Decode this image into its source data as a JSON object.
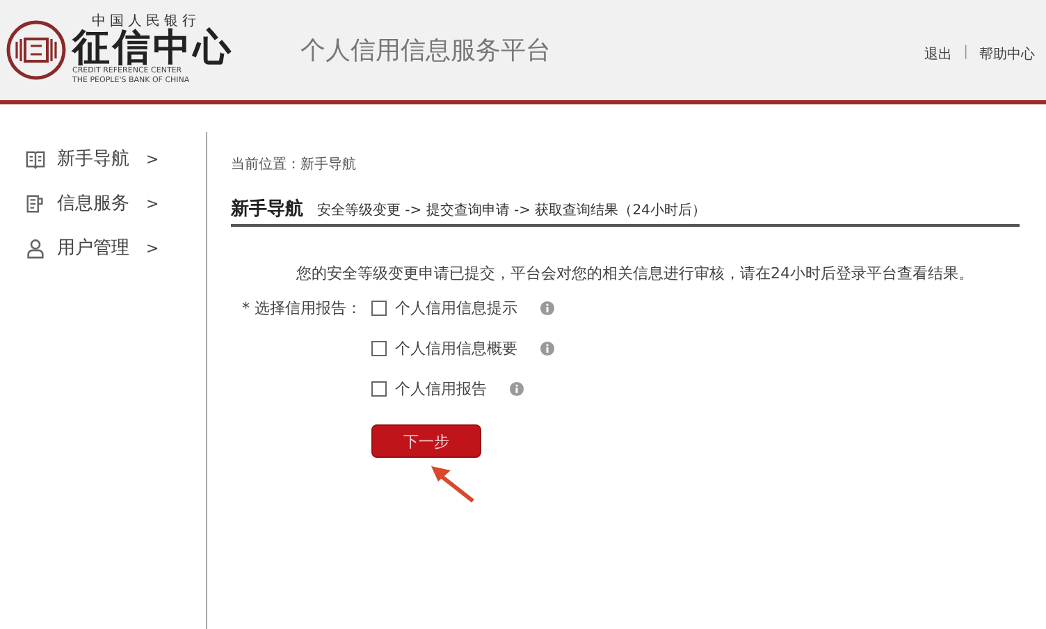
{
  "header": {
    "logo": {
      "top_text": "中国人民银行",
      "name": "征信中心",
      "english_lines": [
        "CREDIT REFERENCE CENTER",
        "THE PEOPLE'S BANK OF CHINA"
      ]
    },
    "platform_title": "个人信用信息服务平台",
    "links": [
      "退出",
      "帮助中心"
    ],
    "separator": "|"
  },
  "sidebar": {
    "items": [
      {
        "kind": "book",
        "label": "新手导航",
        "chevron": ">"
      },
      {
        "kind": "doc",
        "label": "信息服务",
        "chevron": ">"
      },
      {
        "kind": "user",
        "label": "用户管理",
        "chevron": ">"
      }
    ]
  },
  "breadcrumb": "当前位置：新手导航",
  "section": {
    "title": "新手导航",
    "steps": "安全等级变更 -> 提交查询申请 -> 获取查询结果（24小时后）"
  },
  "notice": "您的安全等级变更申请已提交，平台会对您的相关信息进行审核，请在24小时后登录平台查看结果。",
  "report_select": {
    "label": "* 选择信用报告：",
    "options": [
      {
        "label": "个人信用信息提示",
        "checked": false
      },
      {
        "label": "个人信用信息概要",
        "checked": false
      },
      {
        "label": "个人信用报告",
        "checked": false
      }
    ]
  },
  "next_button": "下一步"
}
